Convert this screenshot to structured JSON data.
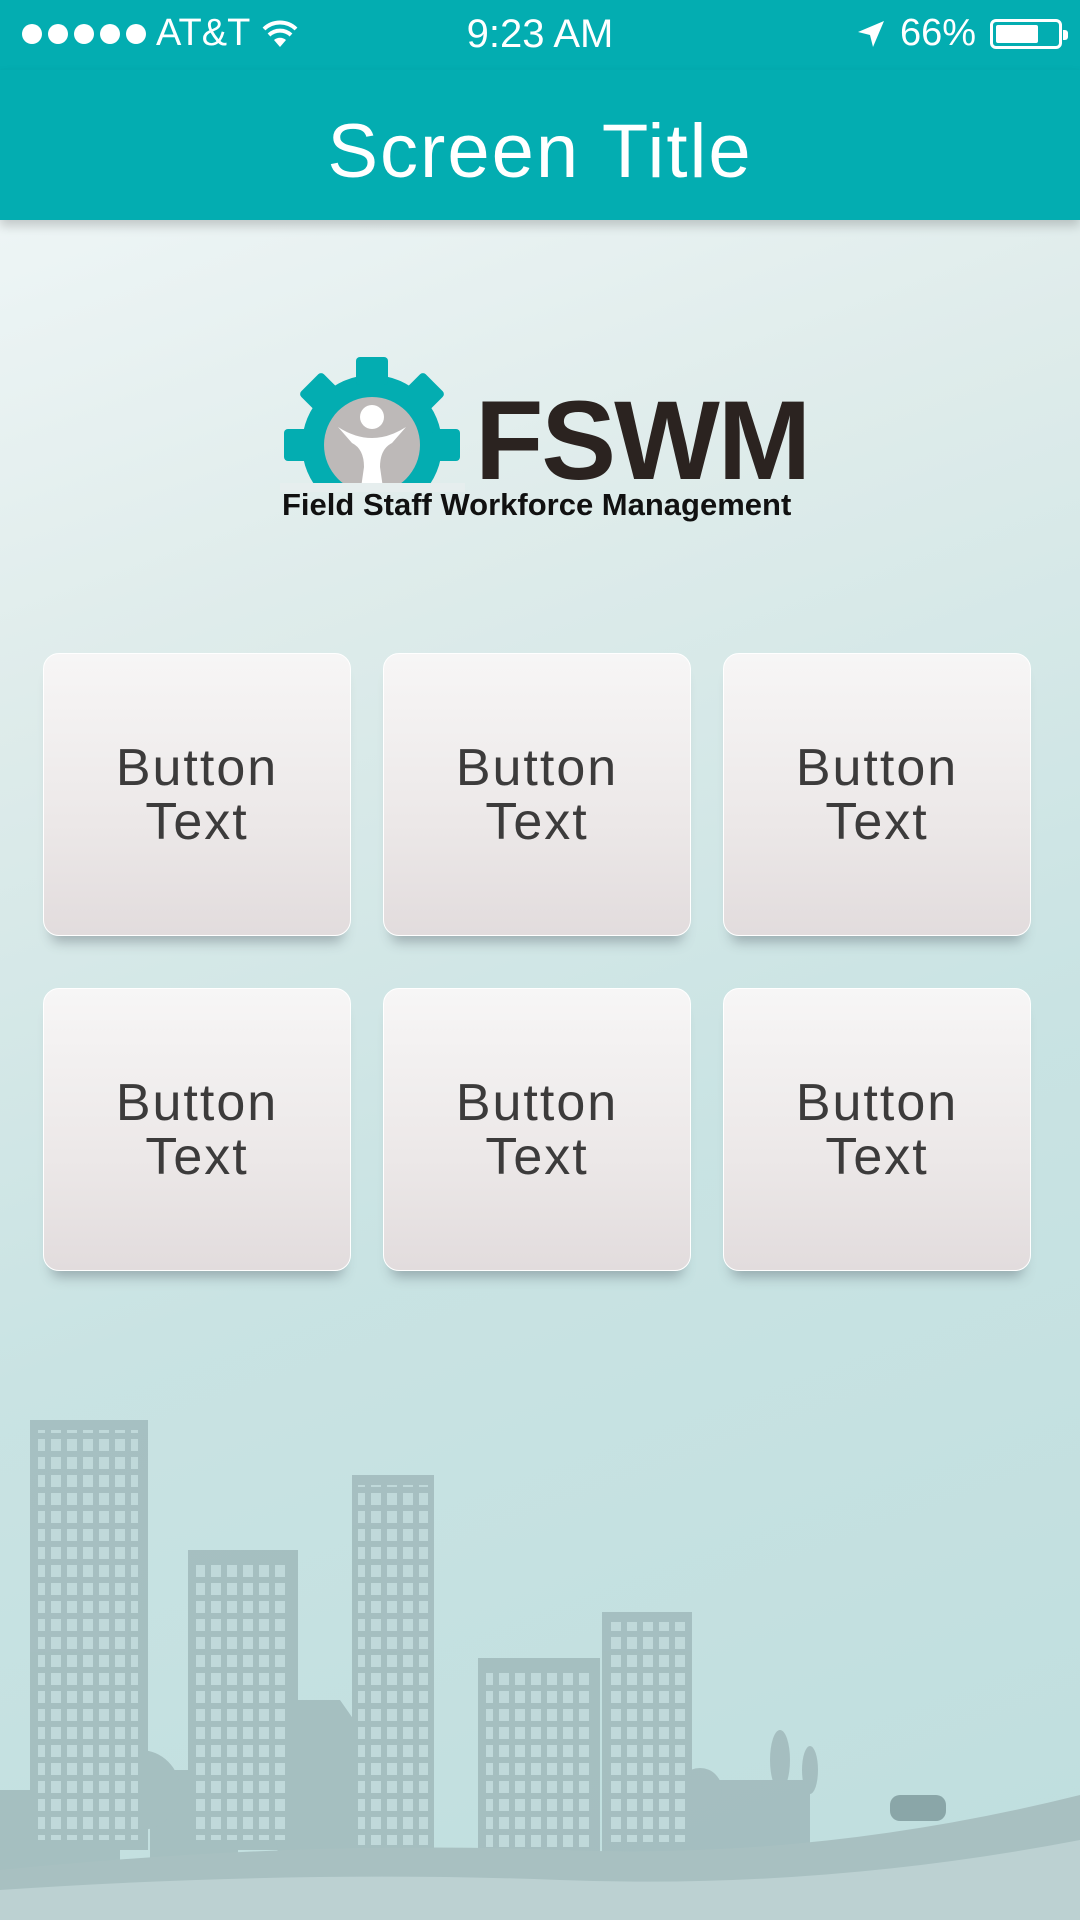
{
  "status_bar": {
    "carrier": "AT&T",
    "signal_dots": 5,
    "time": "9:23 AM",
    "battery_percent": "66%",
    "battery_level": 0.66
  },
  "nav": {
    "title": "Screen Title"
  },
  "logo": {
    "name": "FSWM",
    "tagline": "Field Staff Workforce Management",
    "accent_color": "#03adb1"
  },
  "buttons": [
    {
      "label": "Button Text"
    },
    {
      "label": "Button Text"
    },
    {
      "label": "Button Text"
    },
    {
      "label": "Button Text"
    },
    {
      "label": "Button Text"
    },
    {
      "label": "Button Text"
    }
  ],
  "colors": {
    "primary": "#03adb1",
    "tile_text": "#3c3b3b"
  }
}
